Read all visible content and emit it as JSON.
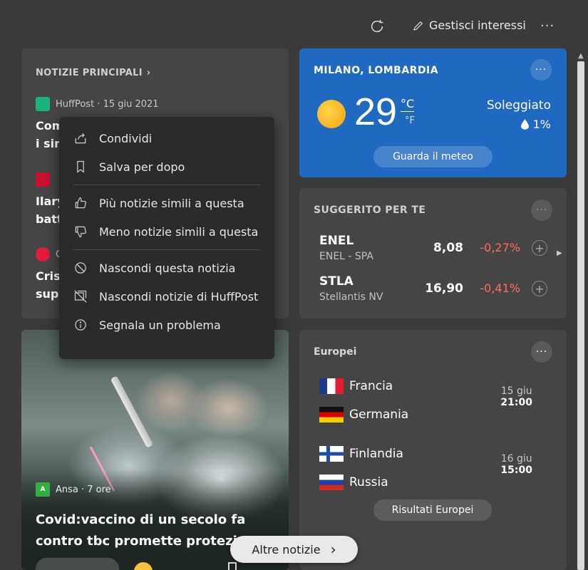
{
  "toolbar": {
    "manage_label": "Gestisci interessi",
    "more_label": "···"
  },
  "top_stories": {
    "title": "NOTIZIE PRINCIPALI",
    "stories": [
      {
        "source": "HuffPost · 15 giu 2021",
        "line1": "Com",
        "line2": "i sint"
      },
      {
        "source": "",
        "line1": "Ilary",
        "line2": "batt"
      },
      {
        "source": "C",
        "line1": "Crist",
        "line2": "supe"
      }
    ]
  },
  "context_menu": {
    "items": [
      "Condividi",
      "Salva per dopo",
      "Più notizie simili a questa",
      "Meno notizie simili a questa",
      "Nascondi questa notizia",
      "Nascondi notizie di HuffPost",
      "Segnala un problema"
    ]
  },
  "weather": {
    "location": "MILANO, LOMBARDIA",
    "temperature": "29",
    "unit_c": "°C",
    "unit_f": "°F",
    "condition": "Soleggiato",
    "precipitation": "1%",
    "button": "Guarda il meteo",
    "more": "···",
    "accent": "#1f6ac0"
  },
  "stocks": {
    "title": "SUGGERITO PER TE",
    "more": "···",
    "rows": [
      {
        "symbol": "ENEL",
        "name": "ENEL - SPA",
        "price": "8,08",
        "change": "-0,27%"
      },
      {
        "symbol": "STLA",
        "name": "Stellantis NV",
        "price": "16,90",
        "change": "-0,41%"
      }
    ],
    "negative_color": "#ff6b5b"
  },
  "sports": {
    "title": "Europei",
    "more": "···",
    "matches": [
      {
        "team1": "Francia",
        "team2": "Germania",
        "date": "15 giu",
        "time": "21:00"
      },
      {
        "team1": "Finlandia",
        "team2": "Russia",
        "date": "16 giu",
        "time": "15:00"
      }
    ],
    "button": "Risultati Europei"
  },
  "image_story": {
    "source": "Ansa · 7 ore",
    "logo_text": "A",
    "headline": "Covid:vaccino di un secolo fa contro tbc promette protezione"
  },
  "more_news": {
    "label": "Altre notizie"
  }
}
